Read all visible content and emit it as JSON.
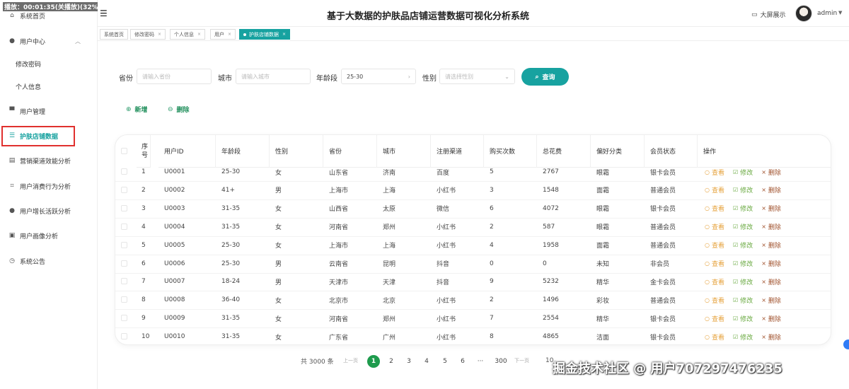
{
  "overlay": {
    "timer": "播放：00:01:35(关播放)(32%)"
  },
  "header": {
    "title": "基于大数据的护肤品店铺运营数据可视化分析系统",
    "bigscreen_label": "大屏展示",
    "user": "admin"
  },
  "sidebar": {
    "items": [
      {
        "label": "系统首页",
        "icon": "home-icon"
      },
      {
        "label": "用户中心",
        "icon": "user-icon"
      },
      {
        "label": "修改密码",
        "icon": ""
      },
      {
        "label": "个人信息",
        "icon": ""
      },
      {
        "label": "用户管理",
        "icon": "users-icon"
      },
      {
        "label": "护肤店铺数据",
        "icon": "list-icon"
      },
      {
        "label": "营销渠道效能分析",
        "icon": "chart-icon"
      },
      {
        "label": "用户消费行为分析",
        "icon": "crop-icon"
      },
      {
        "label": "用户增长活跃分析",
        "icon": "person-icon"
      },
      {
        "label": "用户画像分析",
        "icon": "profile-icon"
      },
      {
        "label": "系统公告",
        "icon": "clock-icon"
      }
    ]
  },
  "tabs": [
    {
      "label": "系统首页"
    },
    {
      "label": "修改密码"
    },
    {
      "label": "个人信息"
    },
    {
      "label": "用户"
    },
    {
      "label": "护肤店铺数据"
    }
  ],
  "search": {
    "province_label": "省份",
    "province_placeholder": "请输入省份",
    "city_label": "城市",
    "city_placeholder": "请输入城市",
    "age_label": "年龄段",
    "age_value": "25-30",
    "gender_label": "性别",
    "gender_placeholder": "请选择性别",
    "query_label": "查询"
  },
  "actions": {
    "add_label": "新增",
    "delete_label": "删除"
  },
  "table": {
    "headers": [
      "序号",
      "用户ID",
      "年龄段",
      "性别",
      "省份",
      "城市",
      "注册渠道",
      "购买次数",
      "总花费",
      "偏好分类",
      "会员状态",
      "操作"
    ],
    "rows": [
      [
        "1",
        "U0001",
        "25-30",
        "女",
        "山东省",
        "济南",
        "百度",
        "5",
        "2767",
        "眼霜",
        "银卡会员"
      ],
      [
        "2",
        "U0002",
        "41+",
        "男",
        "上海市",
        "上海",
        "小红书",
        "3",
        "1548",
        "面霜",
        "普通会员"
      ],
      [
        "3",
        "U0003",
        "31-35",
        "女",
        "山西省",
        "太原",
        "微信",
        "6",
        "4072",
        "眼霜",
        "银卡会员"
      ],
      [
        "4",
        "U0004",
        "31-35",
        "女",
        "河南省",
        "郑州",
        "小红书",
        "2",
        "587",
        "眼霜",
        "普通会员"
      ],
      [
        "5",
        "U0005",
        "25-30",
        "女",
        "上海市",
        "上海",
        "小红书",
        "4",
        "1958",
        "面霜",
        "普通会员"
      ],
      [
        "6",
        "U0006",
        "25-30",
        "男",
        "云南省",
        "昆明",
        "抖音",
        "0",
        "0",
        "未知",
        "非会员"
      ],
      [
        "7",
        "U0007",
        "18-24",
        "男",
        "天津市",
        "天津",
        "抖音",
        "9",
        "5232",
        "精华",
        "金卡会员"
      ],
      [
        "8",
        "U0008",
        "36-40",
        "女",
        "北京市",
        "北京",
        "小红书",
        "2",
        "1496",
        "彩妆",
        "普通会员"
      ],
      [
        "9",
        "U0009",
        "31-35",
        "女",
        "河南省",
        "郑州",
        "小红书",
        "7",
        "2554",
        "精华",
        "银卡会员"
      ],
      [
        "10",
        "U0010",
        "31-35",
        "女",
        "广东省",
        "广州",
        "小红书",
        "8",
        "4865",
        "洁面",
        "银卡会员"
      ]
    ],
    "op_view": "查看",
    "op_edit": "修改",
    "op_delete": "删除"
  },
  "pagination": {
    "total": "共 3000 条",
    "prev": "上一页",
    "next": "下一页",
    "pages": [
      "1",
      "2",
      "3",
      "4",
      "5",
      "6",
      "···",
      "300"
    ],
    "current": "1",
    "size_partial": "10"
  },
  "watermark": "掘金技术社区 @ 用户707297476235",
  "colors": {
    "accent": "#17a2a0",
    "active_page": "#1e9b4d",
    "highlight_box": "#e0302e"
  }
}
